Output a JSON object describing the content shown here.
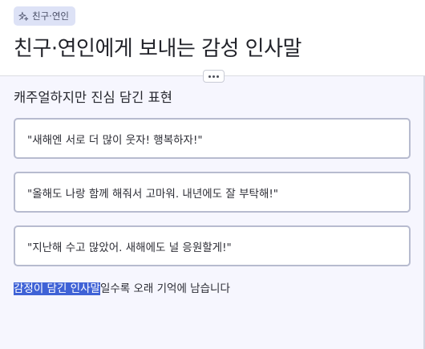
{
  "header": {
    "tag_label": "친구·연인",
    "tag_icon": "sparkles-icon",
    "title": "친구·연인에게 보내는 감성 인사말",
    "more_icon": "more-horizontal-icon"
  },
  "section": {
    "subtitle": "캐주얼하지만 진심 담긴 표현",
    "cards": [
      {
        "text": "\"새해엔 서로 더 많이 웃자! 행복하자!\""
      },
      {
        "text": "\"올해도 나랑 함께 해줘서 고마워. 내년에도 잘 부탁해!\""
      },
      {
        "text": "\"지난해 수고 많았어. 새해에도 널 응원할게!\""
      }
    ],
    "footer_highlight": "감정이 담긴 인사말",
    "footer_rest": "일수록 오래 기억에 남습니다"
  },
  "colors": {
    "tag_bg": "#dde2f6",
    "body_bg": "#f6f6fe",
    "card_border": "#b7bbcf",
    "highlight": "#3f62d6"
  }
}
